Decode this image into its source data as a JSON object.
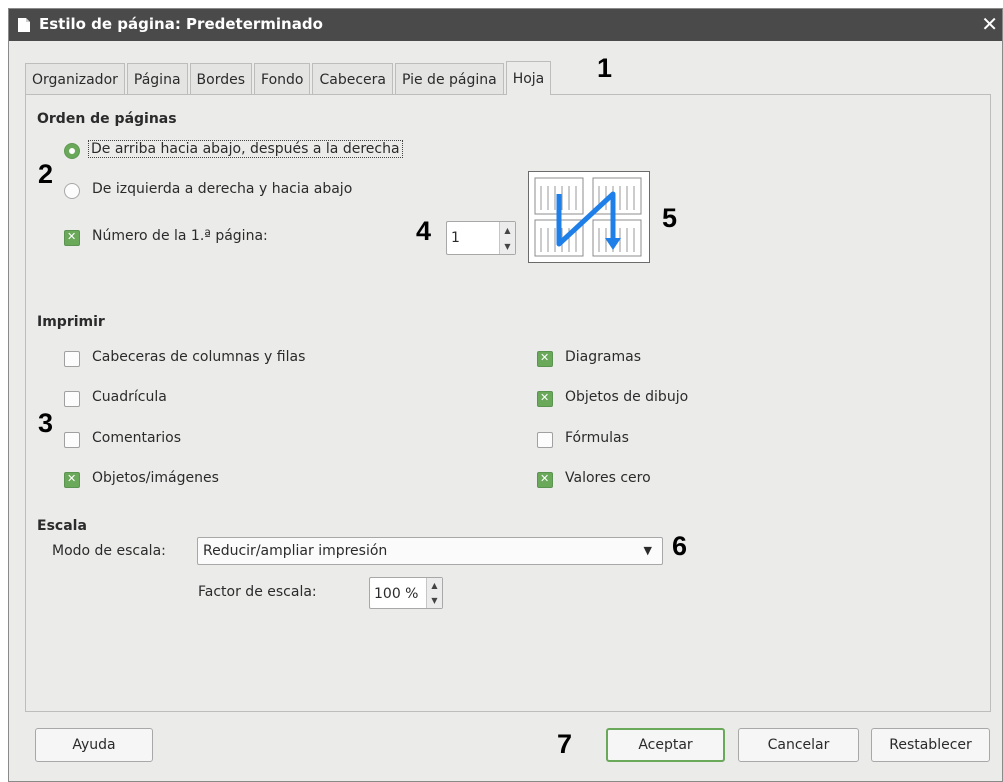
{
  "window": {
    "title": "Estilo de página: Predeterminado",
    "close_glyph": "✕"
  },
  "tabs": [
    {
      "label": "Organizador"
    },
    {
      "label": "Página"
    },
    {
      "label": "Bordes"
    },
    {
      "label": "Fondo"
    },
    {
      "label": "Cabecera"
    },
    {
      "label": "Pie de página"
    },
    {
      "label": "Hoja",
      "active": true
    }
  ],
  "page_order": {
    "heading": "Orden de páginas",
    "option_top_down": "De arriba hacia abajo, después a la derecha",
    "option_left_right": "De izquierda a derecha y hacia abajo",
    "selected": "top_down",
    "first_page_label": "Número de la 1.ª página:",
    "first_page_checked": true,
    "first_page_value": "1"
  },
  "print": {
    "heading": "Imprimir",
    "left": [
      {
        "label": "Cabeceras de columnas y filas",
        "checked": false
      },
      {
        "label": "Cuadrícula",
        "checked": false
      },
      {
        "label": "Comentarios",
        "checked": false
      },
      {
        "label": "Objetos/imágenes",
        "checked": true
      }
    ],
    "right": [
      {
        "label": "Diagramas",
        "checked": true
      },
      {
        "label": "Objetos de dibujo",
        "checked": true
      },
      {
        "label": "Fórmulas",
        "checked": false
      },
      {
        "label": "Valores cero",
        "checked": true
      }
    ]
  },
  "scale": {
    "heading": "Escala",
    "mode_label": "Modo de escala:",
    "mode_value": "Reducir/ampliar impresión",
    "factor_label": "Factor de escala:",
    "factor_value": "100 %"
  },
  "buttons": {
    "help": "Ayuda",
    "ok": "Aceptar",
    "cancel": "Cancelar",
    "reset": "Restablecer"
  },
  "annotations": [
    "1",
    "2",
    "3",
    "4",
    "5",
    "6",
    "7"
  ],
  "colors": {
    "accent_green": "#6aa85a",
    "titlebar": "#4a4a4a",
    "preview_arrow": "#1f7fe8"
  },
  "icons": {
    "title": "document-icon",
    "close": "close-icon",
    "dropdown": "chevron-down-icon"
  }
}
